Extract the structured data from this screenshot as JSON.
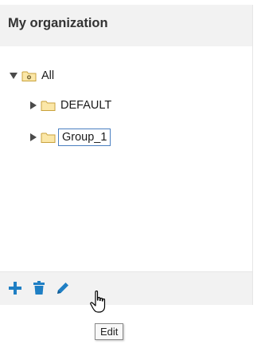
{
  "panel": {
    "title": "My organization"
  },
  "tree": {
    "root": {
      "label": "All",
      "expanded": true,
      "icon": "folder-open-icon"
    },
    "children": [
      {
        "label": "DEFAULT",
        "expanded": false,
        "selected": false,
        "icon": "folder-icon"
      },
      {
        "label": "Group_1",
        "expanded": false,
        "selected": true,
        "icon": "folder-icon"
      }
    ]
  },
  "toolbar": {
    "add_icon": "plus-icon",
    "delete_icon": "trash-icon",
    "edit_icon": "pencil-icon"
  },
  "tooltip": {
    "text": "Edit"
  },
  "colors": {
    "accent": "#1f7fc4",
    "header_bg": "#f2f2f2",
    "folder_fill": "#fbe7a8",
    "folder_stroke": "#c9a23c",
    "selection_border": "#4a7fc1"
  }
}
